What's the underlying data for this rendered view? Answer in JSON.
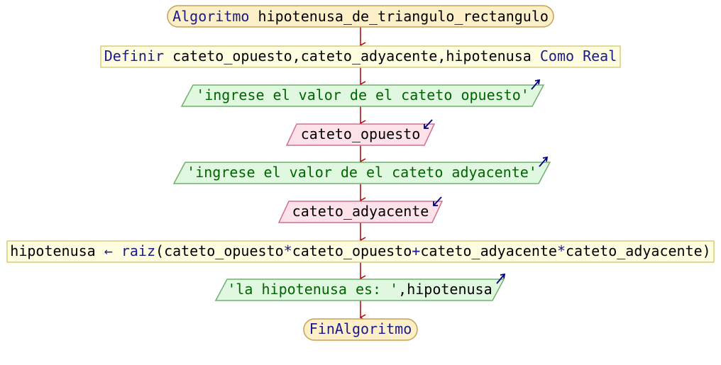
{
  "colors": {
    "keyword": "#1a1a8c",
    "identifier": "#000000",
    "string": "#006400",
    "connector": "#b00000",
    "terminal_fill": "#fdf0c8",
    "terminal_stroke": "#c8a050",
    "process_fill": "#fffde0",
    "process_stroke": "#d8cc7a",
    "output_fill": "#e0f8e0",
    "output_stroke": "#70b070",
    "input_fill": "#fde2ea",
    "input_stroke": "#d07090",
    "io_arrow": "#000080"
  },
  "flowchart": {
    "start": {
      "kw": "Algoritmo",
      "name": "hipotenusa_de_triangulo_rectangulo"
    },
    "define": {
      "kw1": "Definir",
      "vars": "cateto_opuesto,cateto_adyacente,hipotenusa",
      "kw2": "Como",
      "type": "Real"
    },
    "write1": {
      "text": "'ingrese el valor de el cateto opuesto'"
    },
    "read1": {
      "text": "cateto_opuesto"
    },
    "write2": {
      "text": "'ingrese el valor de el cateto adyacente'"
    },
    "read2": {
      "text": "cateto_adyacente"
    },
    "assign": {
      "target": "hipotenusa",
      "arrow": "←",
      "func": "raiz",
      "paren_open": "(",
      "a1": "cateto_opuesto",
      "mul1": "*",
      "a2": "cateto_opuesto",
      "plus": "+",
      "a3": "cateto_adyacente",
      "mul2": "*",
      "a4": "cateto_adyacente",
      "paren_close": ")"
    },
    "write3": {
      "str": "'la hipotenusa es: '",
      "sep": ",",
      "var": "hipotenusa"
    },
    "end": {
      "kw": "FinAlgoritmo"
    }
  }
}
